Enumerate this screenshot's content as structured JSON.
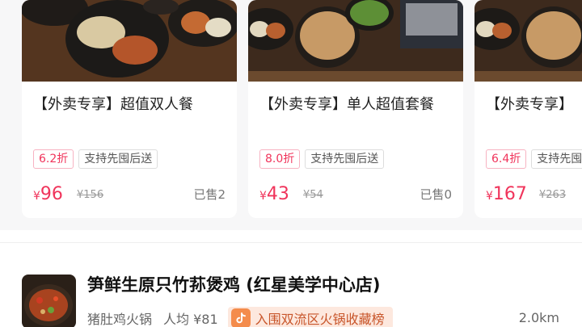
{
  "deals": [
    {
      "title": "【外卖专享】超值双人餐",
      "discount": "6.2折",
      "service_tag": "支持先囤后送",
      "currency": "¥",
      "price": "96",
      "original_price": "¥156",
      "sold": "已售2"
    },
    {
      "title": "【外卖专享】单人超值套餐",
      "discount": "8.0折",
      "service_tag": "支持先囤后送",
      "currency": "¥",
      "price": "43",
      "original_price": "¥54",
      "sold": "已售0"
    },
    {
      "title": "【外卖专享】",
      "discount": "6.4折",
      "service_tag": "支持先囤后送",
      "currency": "¥",
      "price": "167",
      "original_price": "¥263",
      "sold": ""
    }
  ],
  "shop": {
    "name": "笋鲜生原只竹荪煲鸡 (红星美学中心店)",
    "category": "猪肚鸡火锅",
    "avg_price": "人均 ¥81",
    "rank_badge": "入围双流区火锅收藏榜",
    "rank_icon": "douyin-logo-icon",
    "distance": "2.0km"
  },
  "colors": {
    "accent": "#f0345b",
    "badge_bg": "#fde8de",
    "badge_text": "#c8552a"
  }
}
